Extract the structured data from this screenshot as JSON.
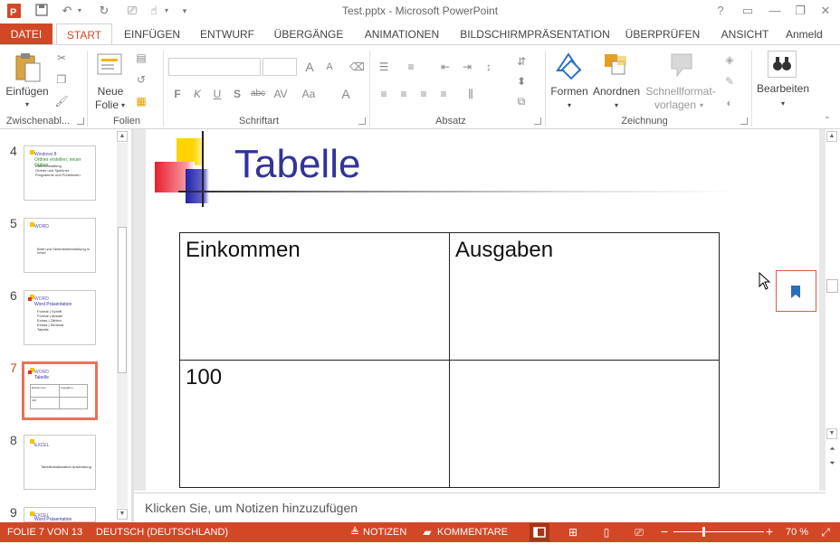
{
  "window": {
    "title": "Test.pptx - Microsoft PowerPoint"
  },
  "quick_access": {
    "app_icon": "powerpoint-icon",
    "save": "save-icon",
    "undo": "undo-icon",
    "redo": "redo-icon",
    "customize": "▾"
  },
  "window_controls": {
    "help": "?",
    "minimize": "—",
    "restore": "❐",
    "close": "✕"
  },
  "tabs": [
    {
      "label": "DATEI"
    },
    {
      "label": "START"
    },
    {
      "label": "EINFÜGEN"
    },
    {
      "label": "ENTWURF"
    },
    {
      "label": "ÜBERGÄNGE"
    },
    {
      "label": "ANIMATIONEN"
    },
    {
      "label": "BILDSCHIRMPRÄSENTATION"
    },
    {
      "label": "ÜBERPRÜFEN"
    },
    {
      "label": "ANSICHT"
    },
    {
      "label": "Anmeld"
    }
  ],
  "ribbon": {
    "clipboard": {
      "paste": "Einfügen",
      "group": "Zwischenabl..."
    },
    "slides": {
      "new_line1": "Neue",
      "new_line2": "Folie",
      "group": "Folien"
    },
    "font": {
      "group": "Schriftart",
      "bold": "F",
      "italic": "K",
      "underline": "U",
      "shadow": "S",
      "strike": "abc",
      "spacing": "AV",
      "case": "Aa",
      "color": "A",
      "grow": "A",
      "shrink": "A"
    },
    "paragraph": {
      "group": "Absatz"
    },
    "drawing": {
      "shapes": "Formen",
      "arrange": "Anordnen",
      "styles_line1": "Schnellformat-",
      "styles_line2": "vorlagen",
      "group": "Zeichnung"
    },
    "editing": {
      "label": "Bearbeiten"
    }
  },
  "slide_pane": {
    "thumbnails": [
      {
        "num": "4",
        "title": "Windows 8",
        "sub": "Ordner erstellen, neuer Ordner",
        "bullets": [
          "Dateiverwaltung",
          "Ordner und Speicher",
          "Programme und Funktionen"
        ]
      },
      {
        "num": "5",
        "title": "WORD",
        "sub": "",
        "bullets": [
          "Brief und Serienbrieferstellung in Word"
        ]
      },
      {
        "num": "6",
        "title": "WORD",
        "sub": "Word Präsentation",
        "bullets": [
          "Format | Schrift",
          "Format | Absatz",
          "Extras | Zählen",
          "Extras | Seriendr",
          "Tabelle"
        ]
      },
      {
        "num": "7",
        "title": "WORD",
        "sub": "Tabelle",
        "bullets": []
      },
      {
        "num": "8",
        "title": "EXCEL",
        "sub": "",
        "bullets": [
          "Tabellenkalkulation Anwendung"
        ]
      },
      {
        "num": "9",
        "title": "EXCEL",
        "sub": "Word Präsentation",
        "bullets": []
      }
    ]
  },
  "slide": {
    "title": "Tabelle",
    "table": [
      [
        "Einkommen",
        "Ausgaben"
      ],
      [
        "100",
        ""
      ]
    ]
  },
  "notes": {
    "placeholder": "Klicken Sie, um Notizen hinzuzufügen"
  },
  "status_bar": {
    "slide_info": "FOLIE 7 VON 13",
    "language": "DEUTSCH (DEUTSCHLAND)",
    "notes": "NOTIZEN",
    "comments": "KOMMENTARE",
    "zoom": "70 %",
    "zoom_level_percent": 70
  },
  "colors": {
    "accent": "#d24726",
    "title_blue": "#333399",
    "thumb_selected": "#e8735a"
  }
}
